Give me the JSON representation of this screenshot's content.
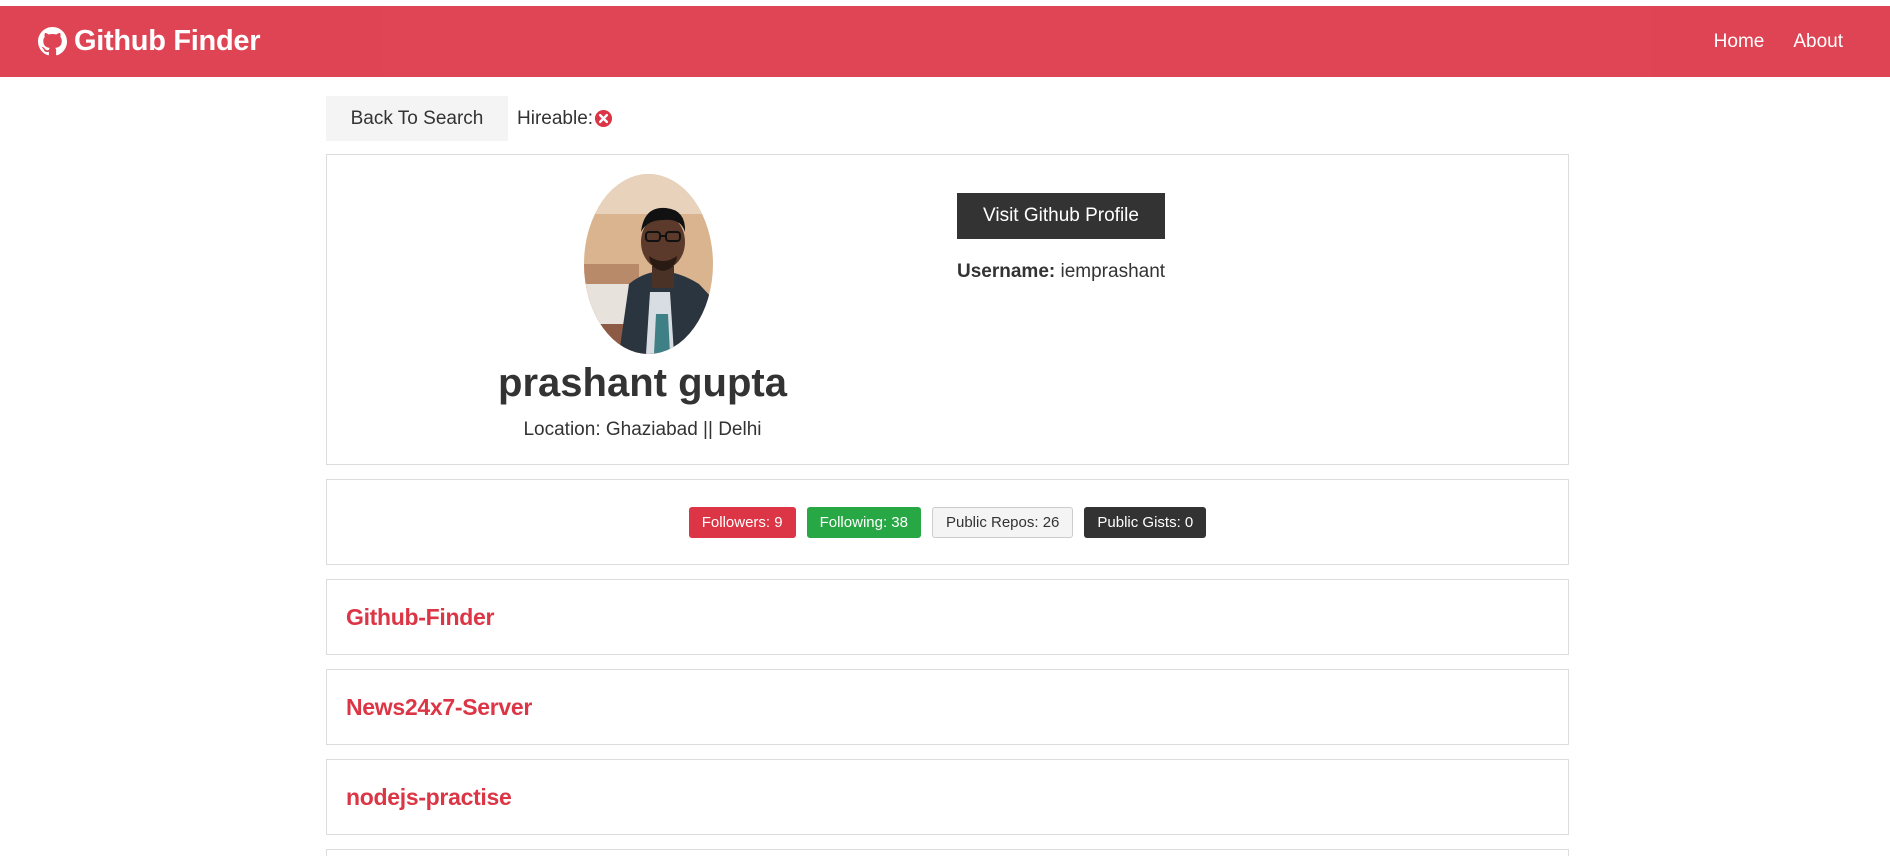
{
  "navbar": {
    "brand": "Github Finder",
    "brand_icon": "github-icon",
    "links": [
      {
        "label": "Home"
      },
      {
        "label": "About"
      }
    ],
    "color": "#dc3545"
  },
  "top_row": {
    "back_label": "Back To Search",
    "hireable_label": "Hireable:",
    "hireable_icon": "times-circle-icon"
  },
  "profile": {
    "name": "prashant gupta",
    "location": "Location: Ghaziabad || Delhi",
    "visit_label": "Visit Github Profile",
    "username_label": "Username:",
    "username_value": "iemprashant"
  },
  "stats": {
    "followers": "Followers: 9",
    "following": "Following: 38",
    "public_repos": "Public Repos: 26",
    "public_gists": "Public Gists: 0"
  },
  "repos": [
    {
      "name": "Github-Finder"
    },
    {
      "name": "News24x7-Server"
    },
    {
      "name": "nodejs-practise"
    }
  ]
}
